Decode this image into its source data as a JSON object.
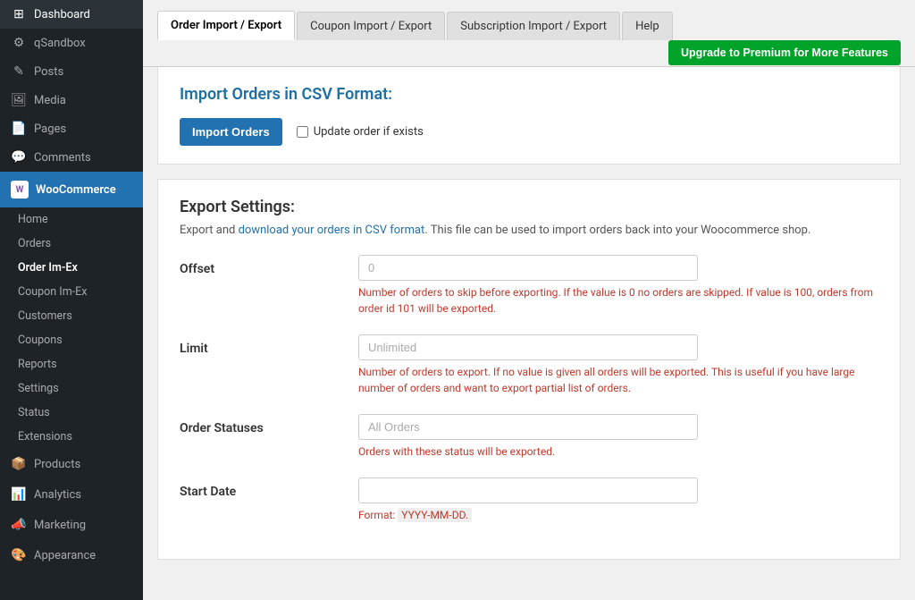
{
  "sidebar": {
    "top_items": [
      {
        "id": "dashboard",
        "label": "Dashboard",
        "icon": "⊞"
      },
      {
        "id": "qsandbox",
        "label": "qSandbox",
        "icon": "⚙"
      }
    ],
    "middle_items": [
      {
        "id": "posts",
        "label": "Posts",
        "icon": "✎"
      },
      {
        "id": "media",
        "label": "Media",
        "icon": "🖼"
      },
      {
        "id": "pages",
        "label": "Pages",
        "icon": "📄"
      },
      {
        "id": "comments",
        "label": "Comments",
        "icon": "💬"
      }
    ],
    "woocommerce": {
      "label": "WooCommerce",
      "sub_items": [
        {
          "id": "home",
          "label": "Home"
        },
        {
          "id": "orders",
          "label": "Orders"
        },
        {
          "id": "order-im-ex",
          "label": "Order Im-Ex",
          "active": true
        },
        {
          "id": "coupon-im-ex",
          "label": "Coupon Im-Ex"
        },
        {
          "id": "customers",
          "label": "Customers"
        },
        {
          "id": "coupons",
          "label": "Coupons"
        },
        {
          "id": "reports",
          "label": "Reports"
        },
        {
          "id": "settings",
          "label": "Settings"
        },
        {
          "id": "status",
          "label": "Status"
        },
        {
          "id": "extensions",
          "label": "Extensions"
        }
      ]
    },
    "bottom_items": [
      {
        "id": "products",
        "label": "Products",
        "icon": "📦"
      },
      {
        "id": "analytics",
        "label": "Analytics",
        "icon": "📊"
      },
      {
        "id": "marketing",
        "label": "Marketing",
        "icon": "📣"
      },
      {
        "id": "appearance",
        "label": "Appearance",
        "icon": "🎨"
      }
    ]
  },
  "tabs": {
    "items": [
      {
        "id": "order-import-export",
        "label": "Order Import / Export",
        "active": true
      },
      {
        "id": "coupon-import-export",
        "label": "Coupon Import / Export"
      },
      {
        "id": "subscription-import-export",
        "label": "Subscription Import / Export"
      },
      {
        "id": "help",
        "label": "Help"
      }
    ],
    "upgrade_button": "Upgrade to Premium for More Features"
  },
  "import_section": {
    "title": "Import Orders in CSV Format:",
    "import_button": "Import Orders",
    "checkbox_label": "Update order if exists"
  },
  "export_section": {
    "title": "Export Settings:",
    "description_plain": "Export and ",
    "description_link": "download your orders in CSV format",
    "description_rest": ". This file can be used to import orders back into your Woocommerce shop.",
    "fields": [
      {
        "id": "offset",
        "label": "Offset",
        "placeholder": "0",
        "help": "Number of orders to skip before exporting. If the value is 0 no orders are skipped. If value is 100, orders from order id 101 will be exported."
      },
      {
        "id": "limit",
        "label": "Limit",
        "placeholder": "Unlimited",
        "help": "Number of orders to export. If no value is given all orders will be exported. This is useful if you have large number of orders and want to export partial list of orders."
      },
      {
        "id": "order-statuses",
        "label": "Order Statuses",
        "placeholder": "All Orders",
        "help": "Orders with these status will be exported."
      },
      {
        "id": "start-date",
        "label": "Start Date",
        "placeholder": "",
        "help": "Format: YYYY-MM-DD."
      }
    ]
  }
}
